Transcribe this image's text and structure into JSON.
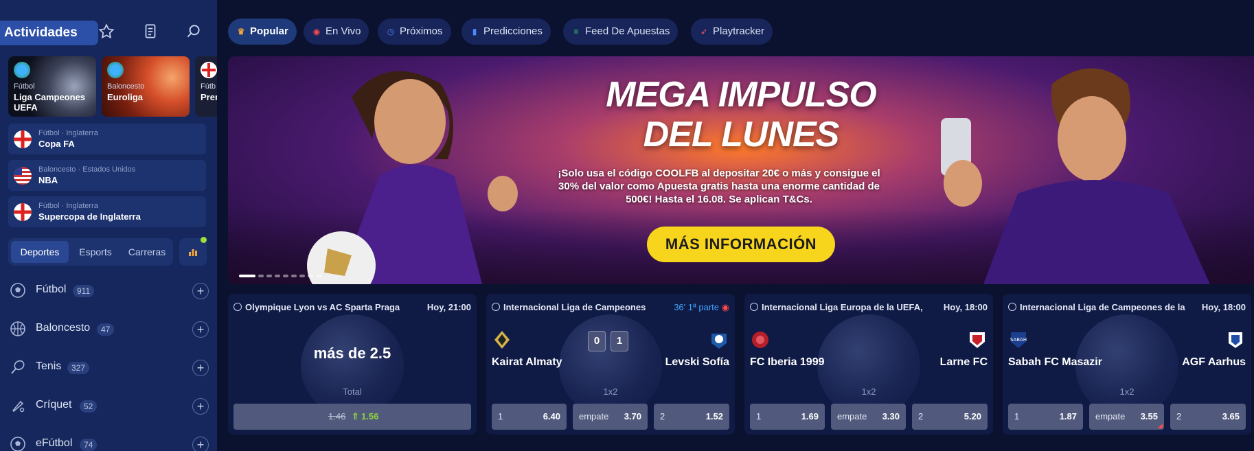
{
  "sidebar": {
    "actividades_label": "Actividades",
    "cards": [
      {
        "sport": "Fútbol",
        "name": "Liga Campeones UEFA"
      },
      {
        "sport": "Baloncesto",
        "name": "Euroliga"
      },
      {
        "sport": "Fútb",
        "name": "Prem"
      }
    ],
    "favorites": [
      {
        "sub": "Fútbol · Inglaterra",
        "title": "Copa FA"
      },
      {
        "sub": "Baloncesto · Estados Unidos",
        "title": "NBA"
      },
      {
        "sub": "Fútbol · Inglaterra",
        "title": "Supercopa de Inglaterra"
      }
    ],
    "tabs": [
      "Deportes",
      "Esports",
      "Carreras"
    ],
    "sports": [
      {
        "label": "Fútbol",
        "count": "911"
      },
      {
        "label": "Baloncesto",
        "count": "47"
      },
      {
        "label": "Tenis",
        "count": "327"
      },
      {
        "label": "Críquet",
        "count": "52"
      },
      {
        "label": "eFútbol",
        "count": "74"
      }
    ]
  },
  "nav": [
    "Popular",
    "En Vivo",
    "Próximos",
    "Predicciones",
    "Feed De Apuestas",
    "Playtracker"
  ],
  "banner": {
    "headline_1": "MEGA IMPULSO",
    "headline_2": "DEL LUNES",
    "text": "¡Solo usa el código COOLFB al depositar 20€ o más y consigue el 30% del valor como Apuesta gratis hasta una enorme cantidad de 500€! Hasta el 16.08. Se aplican T&Cs.",
    "cta": "MÁS INFORMACIÓN"
  },
  "matches": [
    {
      "header": "Olympique Lyon vs AC Sparta Praga",
      "time": "Hoy, 21:00",
      "pick": "más de 2.5",
      "market": "Total",
      "old_odd": "1.46",
      "new_odd": "1.56"
    },
    {
      "header": "Internacional Liga de Campeones",
      "live": "36' 1ª parte",
      "home": "Kairat Almaty",
      "away": "Levski Sofía",
      "score_home": "0",
      "score_away": "1",
      "market": "1x2",
      "odds": [
        {
          "k": "1",
          "v": "6.40"
        },
        {
          "k": "empate",
          "v": "3.70"
        },
        {
          "k": "2",
          "v": "1.52"
        }
      ]
    },
    {
      "header": "Internacional Liga Europa de la UEFA,",
      "time": "Hoy, 18:00",
      "home": "FC Iberia 1999",
      "away": "Larne FC",
      "market": "1x2",
      "odds": [
        {
          "k": "1",
          "v": "1.69"
        },
        {
          "k": "empate",
          "v": "3.30"
        },
        {
          "k": "2",
          "v": "5.20"
        }
      ]
    },
    {
      "header": "Internacional Liga de Campeones de la",
      "time": "Hoy, 18:00",
      "home": "Sabah FC Masazir",
      "away": "AGF Aarhus",
      "market": "1x2",
      "odds": [
        {
          "k": "1",
          "v": "1.87"
        },
        {
          "k": "empate",
          "v": "3.55"
        },
        {
          "k": "2",
          "v": "3.65"
        }
      ]
    }
  ],
  "colors": {
    "sidebar": "#15275c",
    "accent": "#2c4fa8",
    "cta": "#f7d51d",
    "live": "#3fa6ff",
    "up": "#8fd13f"
  }
}
